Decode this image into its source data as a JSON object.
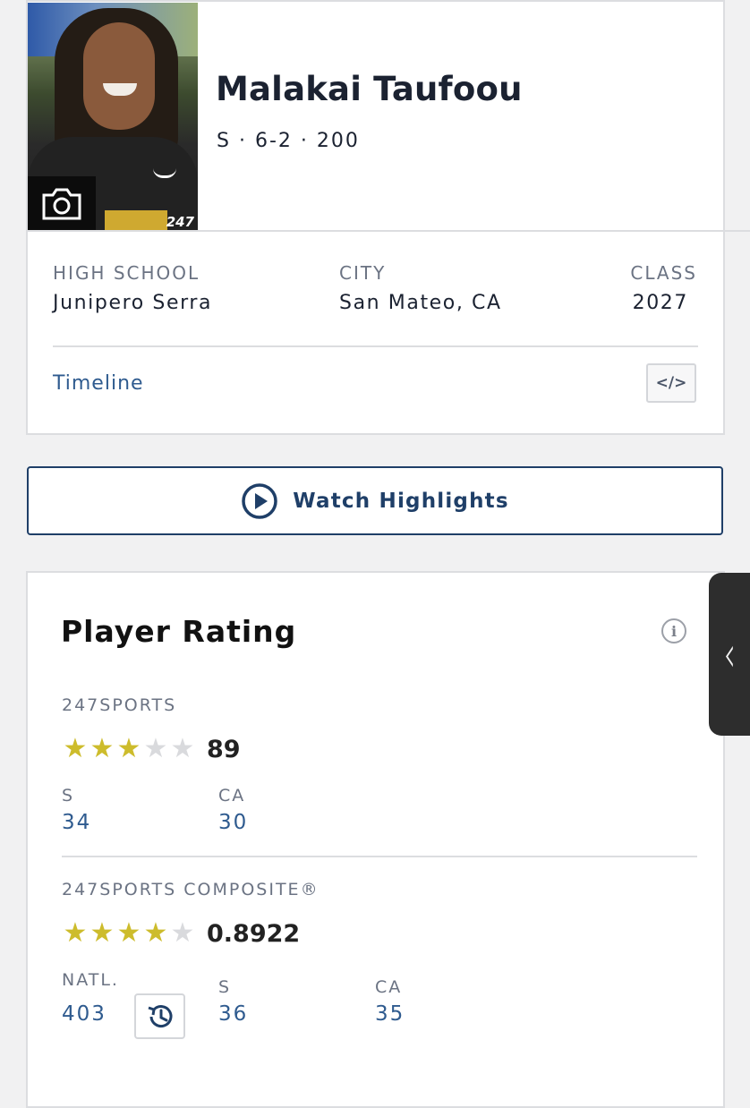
{
  "player": {
    "name": "Malakai Taufoou",
    "meta": "S · 6-2 · 200",
    "photo_watermark": "247"
  },
  "info": {
    "high_school_label": "HIGH SCHOOL",
    "high_school_value": "Junipero Serra",
    "city_label": "CITY",
    "city_value": "San Mateo, CA",
    "class_label": "CLASS",
    "class_value": "2027",
    "timeline_link": "Timeline",
    "embed_icon": "</>"
  },
  "highlights": {
    "label": "Watch Highlights",
    "icon": "play-circle-icon"
  },
  "rating": {
    "title": "Player Rating",
    "info_icon": "i",
    "sports247": {
      "label": "247SPORTS",
      "stars": 3,
      "stars_total": 5,
      "score": "89",
      "ranks": [
        {
          "label": "S",
          "value": "34"
        },
        {
          "label": "CA",
          "value": "30"
        }
      ]
    },
    "composite": {
      "label": "247SPORTS COMPOSITE®",
      "stars": 4,
      "stars_total": 5,
      "score": "0.8922",
      "ranks": [
        {
          "label": "NATL.",
          "value": "403"
        },
        {
          "label": "S",
          "value": "36"
        },
        {
          "label": "CA",
          "value": "35"
        }
      ]
    }
  },
  "side_tab": {
    "icon": "chevron-left-icon",
    "glyph": "‹"
  },
  "colors": {
    "accent": "#2f5b8f",
    "navy": "#1f3f68",
    "star": "#cdbc2c",
    "star_off": "#d9dadd"
  }
}
